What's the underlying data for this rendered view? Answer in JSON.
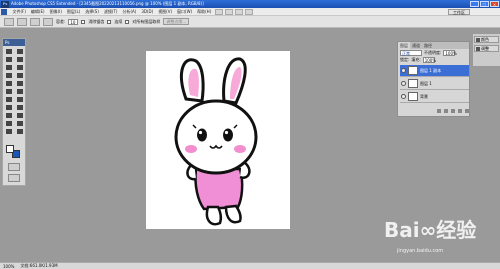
{
  "window": {
    "app_icon": "Ps",
    "title": "Adobe Photoshop CS5 Extended - [2345截图20220213110056.png @ 100% (图层 1 副本, RGB/8)]",
    "buttons": [
      "_",
      "□",
      "×"
    ]
  },
  "menu": {
    "items": [
      "文件(F)",
      "编辑(E)",
      "图像(I)",
      "图层(L)",
      "选择(S)",
      "滤镜(T)",
      "分析(A)",
      "3D(D)",
      "视图(V)",
      "窗口(W)",
      "帮助(H)"
    ],
    "workspace_label": "工作区"
  },
  "options_bar": {
    "size_label": "容差:",
    "size_value": "10",
    "antialias_label": "消除锯齿",
    "contiguous_label": "连续",
    "sample_all_label": "对所有图层取样",
    "refine_edge_label": "调整边缘..."
  },
  "toolbox": {
    "header": "Ps",
    "foreground_color": "#ffffff",
    "background_color": "#1c55b8"
  },
  "layers_panel": {
    "tabs": [
      "图层",
      "通道",
      "路径"
    ],
    "blend_mode": "正常",
    "opacity_label": "不透明度:",
    "opacity_value": "100%",
    "lock_label": "锁定:",
    "fill_label": "填充:",
    "fill_value": "100%",
    "layers": [
      {
        "name": "图层 1 副本",
        "selected": true
      },
      {
        "name": "图层 1",
        "selected": false
      },
      {
        "name": "背景",
        "selected": false
      }
    ]
  },
  "dock": {
    "items": [
      "颜色",
      "调整"
    ]
  },
  "status_bar": {
    "zoom": "100%",
    "doc_info": "文档:661.0K/1.93M"
  },
  "watermark": {
    "brand": "Bai∞经验",
    "url": "jingyan.baidu.com"
  }
}
